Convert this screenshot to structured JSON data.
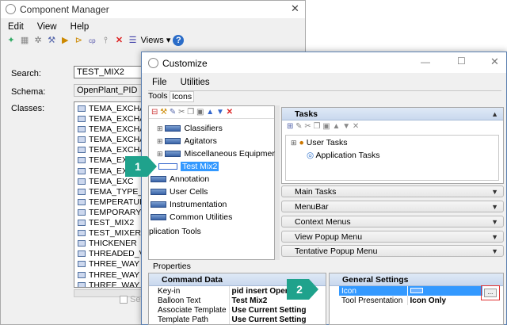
{
  "cm": {
    "title": "Component Manager",
    "menu": [
      "Edit",
      "View",
      "Help"
    ],
    "views_label": "Views",
    "search_label": "Search:",
    "search_value": "TEST_MIX2",
    "schema_label": "Schema:",
    "schema_value": "OpenPlant_PID",
    "classes_label": "Classes:",
    "classes": [
      "TEMA_EXCHA",
      "TEMA_EXCHA",
      "TEMA_EXCHA",
      "TEMA_EXCHA",
      "TEMA_EXCHA",
      "TEMA_EXCH",
      "TEMA_EX",
      "TEMA_EXC",
      "TEMA_TYPE_",
      "TEMPERATUI",
      "TEMPORARY_",
      "TEST_MIX2",
      "TEST_MIXER",
      "THICKENER",
      "THREADED_V",
      "THREE_WAY",
      "THREE_WAY",
      "THREE_WAY"
    ],
    "se_label": "Se"
  },
  "cz": {
    "title": "Customize",
    "menu": [
      "File",
      "Utilities"
    ],
    "tabs": [
      "Tools",
      "Icons"
    ],
    "tree": {
      "items": [
        "Classifiers",
        "Agitators",
        "Miscellaneous Equipment",
        "Test Mix2"
      ],
      "top_items": [
        "Annotation",
        "User Cells",
        "Instrumentation",
        "Common Utilities"
      ],
      "footer": "plication Tools"
    },
    "tasks": {
      "header": "Tasks",
      "items": [
        "User Tasks",
        "Application Tasks"
      ]
    },
    "collapsed": [
      "Main Tasks",
      "MenuBar",
      "Context Menus",
      "View Popup Menu",
      "Tentative Popup Menu"
    ],
    "properties_label": "Properties",
    "command_data": {
      "header": "Command Data",
      "rows": [
        [
          "Key-in",
          "pid insert OpenI"
        ],
        [
          "Balloon Text",
          "Test Mix2"
        ],
        [
          "Associate Template",
          "Use Current Setting"
        ],
        [
          "Template Path",
          "Use Current Setting"
        ]
      ]
    },
    "general_settings": {
      "header": "General Settings",
      "rows": [
        [
          "Icon",
          ""
        ],
        [
          "Tool Presentation",
          "Icon Only"
        ]
      ],
      "browse": "..."
    }
  },
  "callouts": [
    "1",
    "2"
  ],
  "colors": {
    "callout": "#1fa28c",
    "highlight": "#3399ff",
    "red_box": "#e03030"
  }
}
